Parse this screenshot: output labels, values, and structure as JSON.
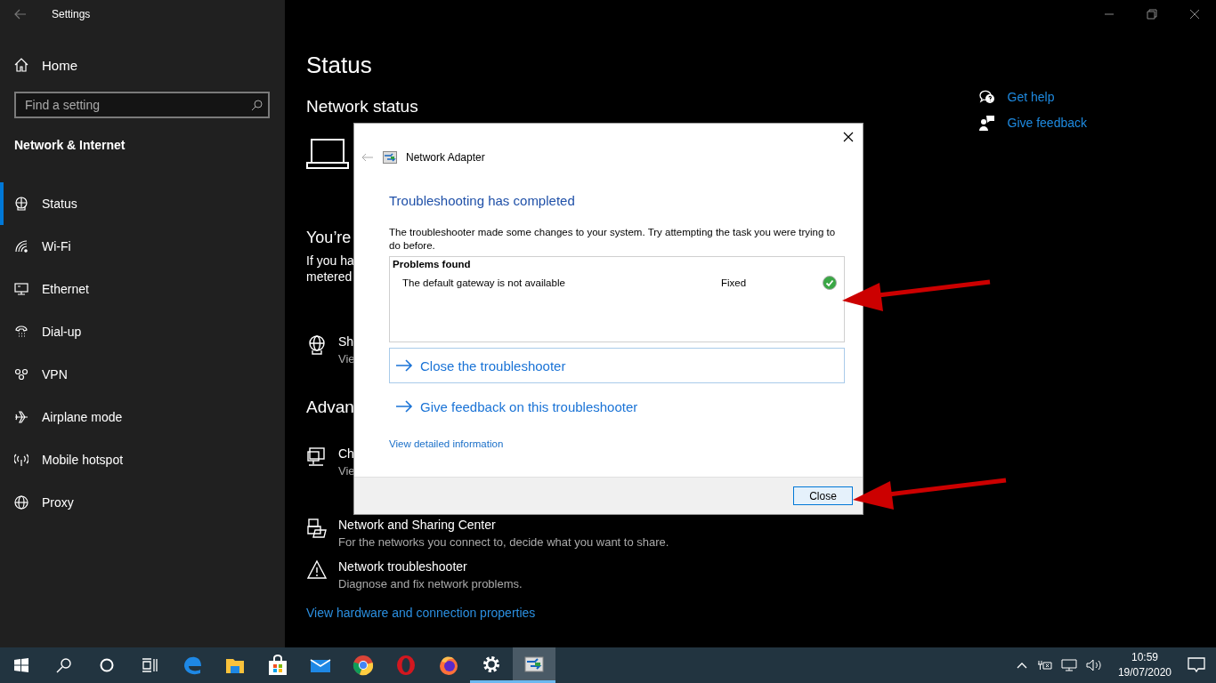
{
  "window": {
    "title": "Settings"
  },
  "sidebar": {
    "home": "Home",
    "search": {
      "placeholder": "Find a setting"
    },
    "section": "Network & Internet",
    "items": [
      {
        "label": "Status",
        "kind": "status",
        "selected": true
      },
      {
        "label": "Wi-Fi",
        "kind": "wifi",
        "selected": false
      },
      {
        "label": "Ethernet",
        "kind": "ethernet",
        "selected": false
      },
      {
        "label": "Dial-up",
        "kind": "dialup",
        "selected": false
      },
      {
        "label": "VPN",
        "kind": "vpn",
        "selected": false
      },
      {
        "label": "Airplane mode",
        "kind": "airplane",
        "selected": false
      },
      {
        "label": "Mobile hotspot",
        "kind": "hotspot",
        "selected": false
      },
      {
        "label": "Proxy",
        "kind": "proxy",
        "selected": false
      }
    ]
  },
  "main": {
    "title": "Status",
    "subtitle": "Network status",
    "connected_heading": "You’re",
    "connected_text": [
      "If you ha",
      "metered"
    ],
    "status_item": {
      "kind": "globe",
      "title": "Sh",
      "text": "Vie"
    },
    "advanced_heading": "Advan",
    "advanced_items": [
      {
        "kind": "adapter",
        "title": "Ch",
        "text": "Vie"
      },
      {
        "kind": "sharing",
        "title": "Network and Sharing Center",
        "text": "For the networks you connect to, decide what you want to share."
      },
      {
        "kind": "warning",
        "title": "Network troubleshooter",
        "text": "Diagnose and fix network problems."
      }
    ],
    "link": "View hardware and connection properties"
  },
  "help_links": [
    {
      "kind": "help",
      "label": "Get help"
    },
    {
      "kind": "feedback",
      "label": "Give feedback"
    }
  ],
  "dialog": {
    "title": "Network Adapter",
    "heading": "Troubleshooting has completed",
    "text": "The troubleshooter made some changes to your system. Try attempting the task you were trying to do before.",
    "problems": {
      "header": "Problems found",
      "rows": [
        {
          "problem": "The default gateway is not available",
          "status": "Fixed",
          "fixed": true
        }
      ]
    },
    "commands": [
      {
        "label": "Close the troubleshooter",
        "selected": true
      },
      {
        "label": "Give feedback on this troubleshooter",
        "selected": false
      }
    ],
    "details_link": "View detailed information",
    "button": "Close"
  },
  "taskbar": {
    "apps": [
      {
        "kind": "edge",
        "running": false,
        "selected": false
      },
      {
        "kind": "explorer",
        "running": false,
        "selected": false
      },
      {
        "kind": "store",
        "running": false,
        "selected": false
      },
      {
        "kind": "mail",
        "running": false,
        "selected": false
      },
      {
        "kind": "chrome",
        "running": false,
        "selected": false
      },
      {
        "kind": "opera",
        "running": false,
        "selected": false
      },
      {
        "kind": "firefox",
        "running": false,
        "selected": false
      },
      {
        "kind": "settings",
        "running": true,
        "selected": false
      },
      {
        "kind": "troubleshooter",
        "running": true,
        "selected": true
      }
    ],
    "time": "10:59",
    "date": "19/07/2020"
  }
}
